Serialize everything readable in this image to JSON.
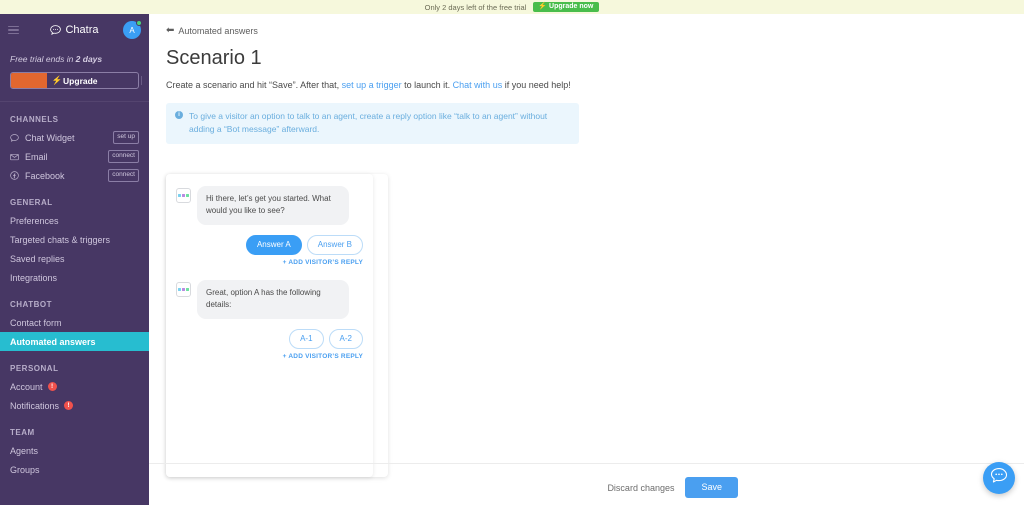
{
  "trial_banner": {
    "text": "Only 2 days left of the free trial",
    "upgrade_label": "Upgrade now",
    "bolt_icon": "bolt-icon",
    "accent": "#49bd4b"
  },
  "sidebar": {
    "brand": "Chatra",
    "brand_icon": "chat-bubble-icon",
    "menu_icon": "hamburger-icon",
    "avatar_initial": "A",
    "status": "online",
    "trial_note_prefix": "Free trial ends in ",
    "trial_note_value": "2 days",
    "upgrade_label": "Upgrade",
    "upgrade_icon": "bolt-icon",
    "background": "#473764",
    "active_color": "#27bdd0",
    "sections": [
      {
        "title": "CHANNELS",
        "items": [
          {
            "label": "Chat Widget",
            "icon": "chat-bubble-icon",
            "badge": "set up",
            "active": false
          },
          {
            "label": "Email",
            "icon": "envelope-icon",
            "badge": "connect",
            "active": false
          },
          {
            "label": "Facebook",
            "icon": "facebook-icon",
            "badge": "connect",
            "active": false
          }
        ]
      },
      {
        "title": "GENERAL",
        "items": [
          {
            "label": "Preferences",
            "icon": "",
            "badge": "",
            "active": false
          },
          {
            "label": "Targeted chats & triggers",
            "icon": "",
            "badge": "",
            "active": false
          },
          {
            "label": "Saved replies",
            "icon": "",
            "badge": "",
            "active": false
          },
          {
            "label": "Integrations",
            "icon": "",
            "badge": "",
            "active": false
          }
        ]
      },
      {
        "title": "CHATBOT",
        "items": [
          {
            "label": "Contact form",
            "icon": "",
            "badge": "",
            "active": false
          },
          {
            "label": "Automated answers",
            "icon": "",
            "badge": "",
            "active": true
          }
        ]
      },
      {
        "title": "PERSONAL",
        "items": [
          {
            "label": "Account",
            "icon": "",
            "badge": "",
            "alert": "!",
            "active": false
          },
          {
            "label": "Notifications",
            "icon": "",
            "badge": "",
            "alert": "!",
            "active": false
          }
        ]
      },
      {
        "title": "TEAM",
        "items": [
          {
            "label": "Agents",
            "icon": "",
            "badge": "",
            "active": false
          },
          {
            "label": "Groups",
            "icon": "",
            "badge": "",
            "active": false
          }
        ]
      }
    ]
  },
  "main": {
    "back_label": "Automated answers",
    "back_icon": "arrow-left-icon",
    "title": "Scenario 1",
    "subtitle": {
      "part1": "Create a scenario and hit “Save”. After that, ",
      "link1": "set up a trigger",
      "part2": " to launch it. ",
      "link2": "Chat with us",
      "part3": " if you need help!"
    },
    "notice": {
      "icon": "info-icon",
      "text": "To give a visitor an option to talk to an agent, create a reply option like “talk to an agent” without adding a “Bot message” afterward."
    },
    "scenario": {
      "bot_avatar_icon": "bot-avatar-icon",
      "messages": [
        {
          "text": "Hi there, let’s get you started. What would you like to see?",
          "replies": [
            {
              "label": "Answer A",
              "style": "filled"
            },
            {
              "label": "Answer B",
              "style": "outline"
            }
          ],
          "add_reply_label": "+ ADD VISITOR’S REPLY"
        },
        {
          "text": "Great, option A has the following details:",
          "replies": [
            {
              "label": "A-1",
              "style": "outline"
            },
            {
              "label": "A-2",
              "style": "outline"
            }
          ],
          "add_reply_label": "+ ADD VISITOR’S REPLY"
        }
      ]
    },
    "footer": {
      "discard_label": "Discard changes",
      "save_label": "Save",
      "save_color": "#4a9ff0"
    }
  },
  "chat_fab": {
    "icon": "chat-bubble-icon",
    "color": "#3a9ef5"
  }
}
